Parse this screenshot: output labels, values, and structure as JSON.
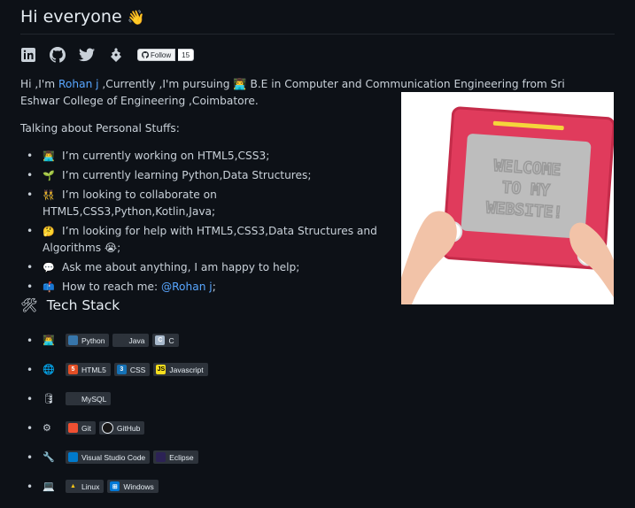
{
  "header": {
    "title": "Hi everyone",
    "wave_emoji": "👋"
  },
  "social": {
    "icons": [
      "linkedin-icon",
      "github-icon",
      "twitter-icon",
      "gitlab-icon"
    ],
    "follow_label": "Follow",
    "follow_count": "15"
  },
  "intro": {
    "part1": "Hi ,I'm ",
    "name": "Rohan j",
    "part2": " ,Currently ,I'm pursuing ",
    "emoji": "👨‍💻",
    "part3": " B.E in Computer and Communication Engineering from Sri Eshwar College of Engineering ,Coimbatore."
  },
  "personal": {
    "heading": "Talking about Personal Stuffs:",
    "items": [
      {
        "emoji": "👨‍💻",
        "text": "I’m currently working on HTML5,CSS3;"
      },
      {
        "emoji": "🌱",
        "text": "I’m currently learning Python,Data Structures;"
      },
      {
        "emoji": "👯",
        "text": "I’m looking to collaborate on HTML5,CSS3,Python,Kotlin,Java;"
      },
      {
        "emoji": "🤔",
        "text": "I’m looking for help with HTML5,CSS3,Data Structures and Algorithms",
        "suffix_emoji": "😭",
        "suffix": ";"
      },
      {
        "emoji": "💬",
        "text": "Ask me about anything, I am happy to help;"
      },
      {
        "emoji": "📫",
        "text": "How to reach me: ",
        "link": "@Rohan j",
        "suffix": ";"
      }
    ]
  },
  "welcome_image": {
    "lines": [
      "WELCOME",
      "TO MY",
      "WEBSITE!"
    ]
  },
  "tech": {
    "heading": "Tech Stack",
    "heading_emoji": "🛠",
    "rows": [
      {
        "emoji": "👨‍💻",
        "badges": [
          {
            "label": "Python",
            "color": "#3776ab",
            "icon": "python-icon"
          },
          {
            "label": "Java",
            "color": "#2d333b",
            "icon": "java-icon"
          },
          {
            "label": "C",
            "color": "#a8b9cc",
            "icon": "c-icon",
            "glyph": "C"
          }
        ]
      },
      {
        "emoji": "🌐",
        "badges": [
          {
            "label": "HTML5",
            "color": "#e34f26",
            "icon": "html5-icon",
            "glyph": "5"
          },
          {
            "label": "CSS",
            "color": "#1572b6",
            "icon": "css-icon",
            "glyph": "3"
          },
          {
            "label": "Javascript",
            "color": "#f7df1e",
            "icon": "javascript-icon",
            "glyph": "JS"
          }
        ]
      },
      {
        "emoji": "🛢",
        "badges": [
          {
            "label": "MySQL",
            "color": "#2d333b",
            "icon": "mysql-icon"
          }
        ]
      },
      {
        "emoji": "⚙",
        "badges": [
          {
            "label": "Git",
            "color": "#f05032",
            "icon": "git-icon"
          },
          {
            "label": "GitHub",
            "color": "#181717",
            "icon": "github-icon"
          }
        ]
      },
      {
        "emoji": "🔧",
        "badges": [
          {
            "label": "Visual Studio Code",
            "color": "#007acc",
            "icon": "vscode-icon"
          },
          {
            "label": "Eclipse",
            "color": "#2c2255",
            "icon": "eclipse-icon"
          }
        ]
      },
      {
        "emoji": "💻",
        "badges": [
          {
            "label": "Linux",
            "color": "#2d333b",
            "icon": "linux-icon"
          },
          {
            "label": "Windows",
            "color": "#0078d6",
            "icon": "windows-icon"
          }
        ]
      }
    ]
  }
}
